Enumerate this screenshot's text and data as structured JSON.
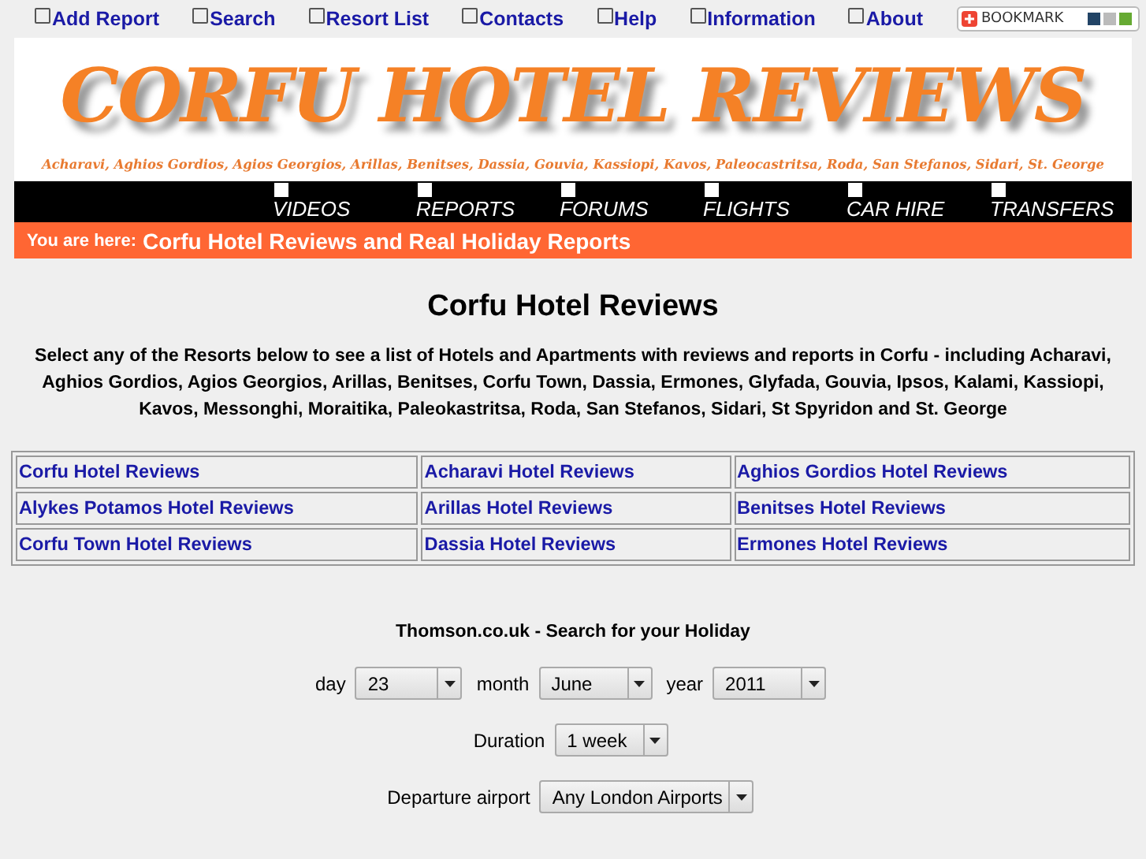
{
  "top_nav": [
    "Add Report",
    "Search",
    "Resort List",
    "Contacts",
    "Help",
    "Information",
    "About"
  ],
  "bookmark": {
    "label": "BOOKMARK"
  },
  "logo": {
    "title": "CORFU HOTEL REVIEWS",
    "subtitle": "Acharavi, Aghios Gordios, Agios Georgios, Arillas, Benitses, Dassia, Gouvia, Kassiopi, Kavos, Paleocastritsa, Roda, San Stefanos, Sidari, St. George"
  },
  "main_nav": [
    "VIDEOS",
    "REPORTS",
    "FORUMS",
    "FLIGHTS",
    "CAR HIRE",
    "TRANSFERS"
  ],
  "breadcrumb": {
    "label": "You are here:",
    "text": "Corfu Hotel Reviews and Real Holiday Reports"
  },
  "heading": "Corfu Hotel Reviews",
  "intro": "Select any of the Resorts below to see a list of Hotels and Apartments with reviews and reports in Corfu - including Acharavi, Aghios Gordios, Agios Georgios, Arillas, Benitses, Corfu Town, Dassia, Ermones, Glyfada, Gouvia, Ipsos, Kalami, Kassiopi, Kavos, Messonghi, Moraitika, Paleokastritsa, Roda, San Stefanos, Sidari, St Spyridon and St. George",
  "resort_links": [
    [
      "Corfu Hotel Reviews",
      "Acharavi Hotel Reviews",
      "Aghios Gordios Hotel Reviews"
    ],
    [
      "Alykes Potamos Hotel Reviews",
      "Arillas Hotel Reviews",
      "Benitses Hotel Reviews"
    ],
    [
      "Corfu Town Hotel Reviews",
      "Dassia Hotel Reviews",
      "Ermones Hotel Reviews"
    ]
  ],
  "search": {
    "title": "Thomson.co.uk - Search for your Holiday",
    "rows": [
      [
        {
          "label": "day",
          "value": "23"
        },
        {
          "label": "month",
          "value": "June"
        },
        {
          "label": "year",
          "value": "2011"
        }
      ],
      [
        {
          "label": "Duration",
          "value": "1 week"
        }
      ],
      [
        {
          "label": "Departure airport",
          "value": "Any London Airports"
        }
      ]
    ]
  }
}
